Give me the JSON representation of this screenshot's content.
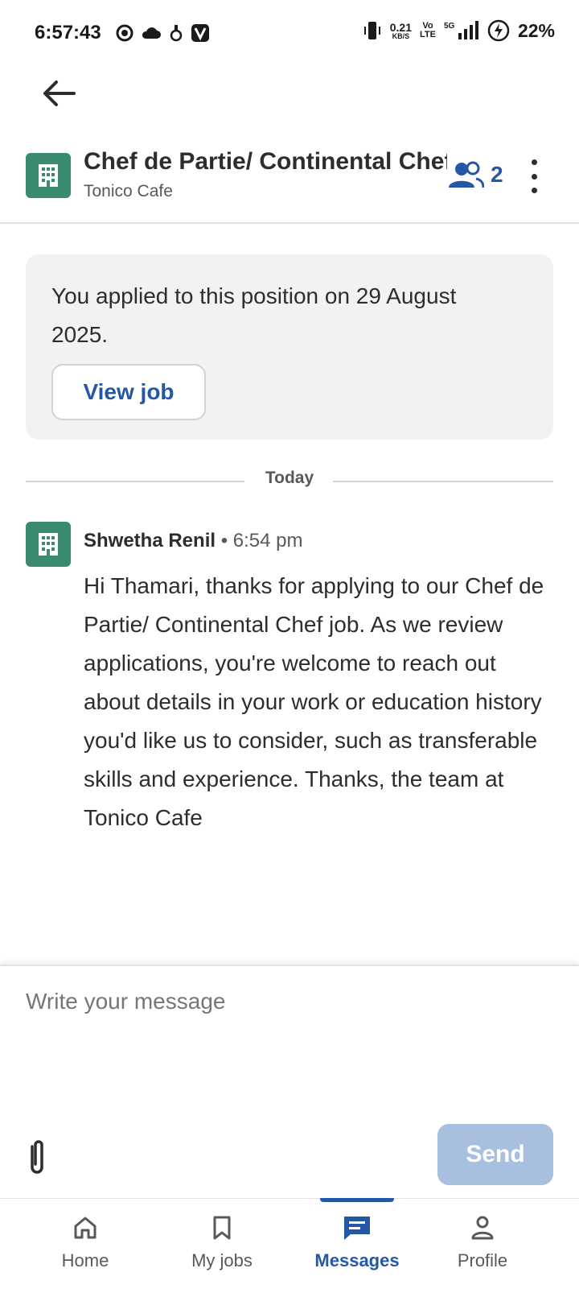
{
  "status_bar": {
    "time": "6:57:43",
    "speed_value": "0.21",
    "speed_unit": "KB/S",
    "volte_top": "Vo",
    "volte_bottom": "LTE",
    "network": "5G",
    "battery": "22%"
  },
  "header": {
    "job_title": "Chef de Partie/ Continental Chef",
    "company": "Tonico Cafe",
    "participants_count": "2"
  },
  "applied_card": {
    "text": "You applied to this position on 29 August 2025.",
    "view_job_label": "View job"
  },
  "divider": {
    "label": "Today"
  },
  "message": {
    "sender": "Shwetha Renil",
    "separator": " • ",
    "time": "6:54 pm",
    "body": "Hi Thamari, thanks for applying to our Chef de Partie/ Continental Chef job. As we review applications, you're welcome to reach out about details in your work or education history you'd like us to consider, such as transferable skills and experience. Thanks, the team at Tonico Cafe"
  },
  "compose": {
    "placeholder": "Write your message",
    "send_label": "Send"
  },
  "bottom_nav": {
    "items": [
      {
        "label": "Home",
        "icon": "home-icon",
        "active": false
      },
      {
        "label": "My jobs",
        "icon": "bookmark-icon",
        "active": false
      },
      {
        "label": "Messages",
        "icon": "message-icon",
        "active": true
      },
      {
        "label": "Profile",
        "icon": "person-icon",
        "active": false
      }
    ]
  },
  "colors": {
    "accent": "#2557a7",
    "logo_bg": "#3a8a72",
    "send_disabled": "#a9bfe0",
    "card_bg": "#f3f2f1"
  }
}
